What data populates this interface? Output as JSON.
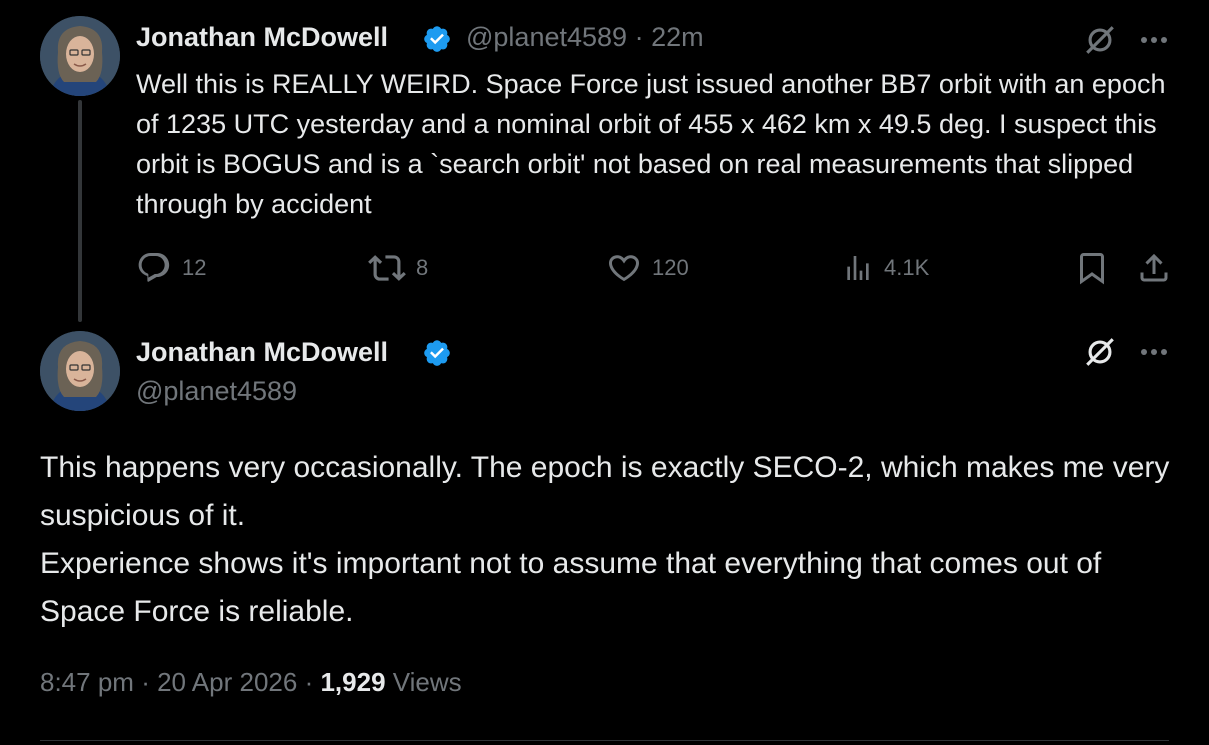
{
  "parent_tweet": {
    "author_name": "Jonathan McDowell",
    "handle": "@planet4589",
    "separator": "·",
    "time_ago": "22m",
    "text": "Well this is REALLY WEIRD. Space Force just issued another BB7 orbit with an epoch of 1235 UTC yesterday and a nominal orbit of 455 x 462 km x 49.5 deg. I suspect this orbit is BOGUS and is a `search orbit' not based on real measurements that slipped through by accident",
    "replies": "12",
    "reposts": "8",
    "likes": "120",
    "views": "4.1K"
  },
  "main_tweet": {
    "author_name": "Jonathan McDowell",
    "handle": "@planet4589",
    "text_line1": "This happens very occasionally. The epoch is exactly SECO-2, which makes me very suspicious of it.",
    "text_line2": "Experience shows it's important not to assume that everything that comes out of Space Force is reliable.",
    "time": "8:47 pm",
    "sep1": "·",
    "date": "20 Apr 2026",
    "sep2": "·",
    "view_count": "1,929",
    "views_label": "Views"
  },
  "colors": {
    "background": "#000000",
    "text": "#e7e9ea",
    "muted": "#71767b",
    "verified": "#1d9bf0"
  },
  "icons": [
    "grok-icon",
    "more-icon",
    "reply-icon",
    "repost-icon",
    "like-icon",
    "views-icon",
    "bookmark-icon",
    "share-icon",
    "verified-icon"
  ]
}
